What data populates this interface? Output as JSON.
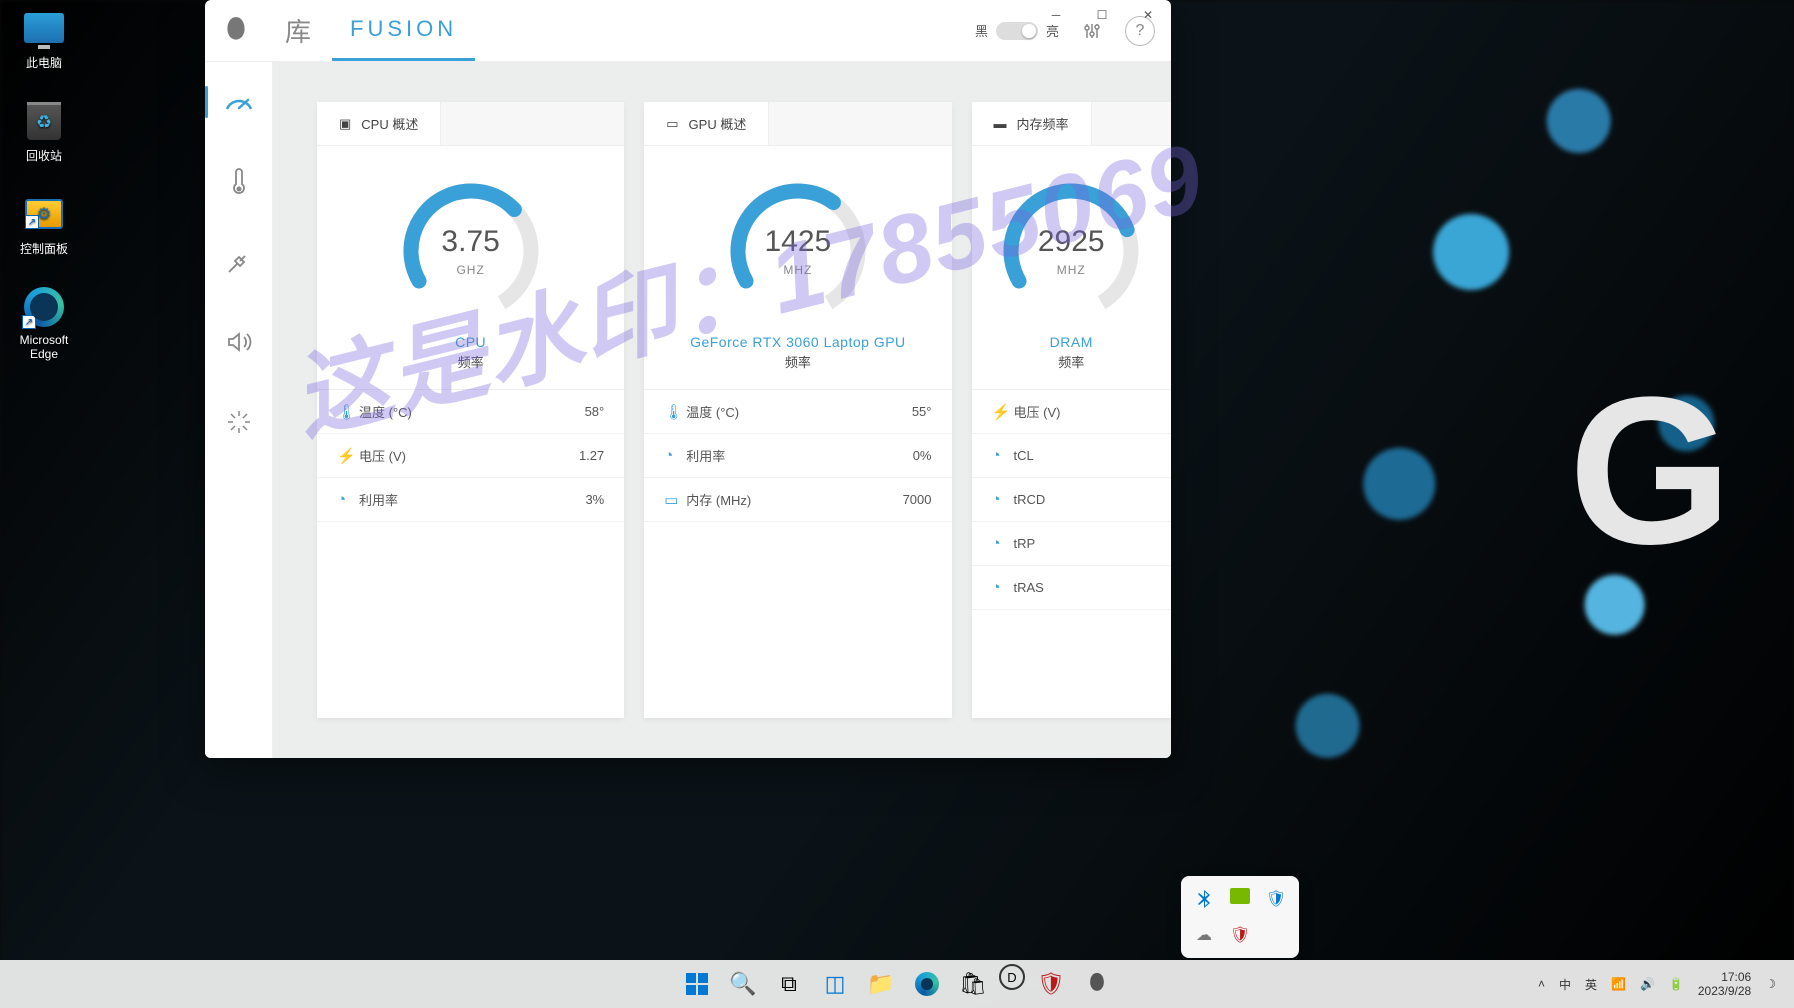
{
  "desktop": {
    "icons": [
      {
        "label": "此电脑",
        "name": "desktop-icon-thispc"
      },
      {
        "label": "回收站",
        "name": "desktop-icon-recyclebin"
      },
      {
        "label": "控制面板",
        "name": "desktop-icon-controlpanel"
      },
      {
        "label": "Microsoft Edge",
        "name": "desktop-icon-edge"
      }
    ],
    "wallpaper_logo": "G"
  },
  "app": {
    "tabs": {
      "library": "库",
      "fusion": "FUSION"
    },
    "theme": {
      "dark": "黑",
      "light": "亮"
    },
    "sidebar": [
      {
        "name": "sidebar-dashboard",
        "icon": "gauge"
      },
      {
        "name": "sidebar-thermal",
        "icon": "thermometer"
      },
      {
        "name": "sidebar-power",
        "icon": "plug"
      },
      {
        "name": "sidebar-audio",
        "icon": "speaker"
      },
      {
        "name": "sidebar-overclock",
        "icon": "burst"
      }
    ],
    "cards": {
      "cpu": {
        "title": "CPU 概述",
        "value": "3.75",
        "unit": "GHZ",
        "label": "CPU",
        "sub": "频率",
        "pct": 0.62,
        "rows": [
          {
            "icon": "🌡",
            "label": "温度 (°C)",
            "value": "58°"
          },
          {
            "icon": "⚡",
            "label": "电压 (V)",
            "value": "1.27"
          },
          {
            "icon": "◔",
            "label": "利用率",
            "value": "3%"
          }
        ]
      },
      "gpu": {
        "title": "GPU 概述",
        "value": "1425",
        "unit": "MHZ",
        "label": "GeForce RTX 3060 Laptop GPU",
        "sub": "频率",
        "pct": 0.58,
        "rows": [
          {
            "icon": "🌡",
            "label": "温度 (°C)",
            "value": "55°"
          },
          {
            "icon": "◔",
            "label": "利用率",
            "value": "0%"
          },
          {
            "icon": "▭",
            "label": "内存 (MHz)",
            "value": "7000"
          }
        ]
      },
      "mem": {
        "title": "内存频率",
        "value": "2925",
        "unit": "MHZ",
        "label": "DRAM",
        "sub": "频率",
        "pct": 0.7,
        "rows": [
          {
            "icon": "⚡",
            "label": "电压 (V)",
            "value": ""
          },
          {
            "icon": "◔",
            "label": "tCL",
            "value": ""
          },
          {
            "icon": "◔",
            "label": "tRCD",
            "value": ""
          },
          {
            "icon": "◔",
            "label": "tRP",
            "value": ""
          },
          {
            "icon": "◔",
            "label": "tRAS",
            "value": ""
          }
        ]
      }
    }
  },
  "watermark": "这是水印：17855069",
  "taskbar": {
    "lang": "英",
    "ime": "中",
    "time": "17:06",
    "date": "2023/9/28"
  },
  "colors": {
    "accent": "#39a0d8"
  }
}
